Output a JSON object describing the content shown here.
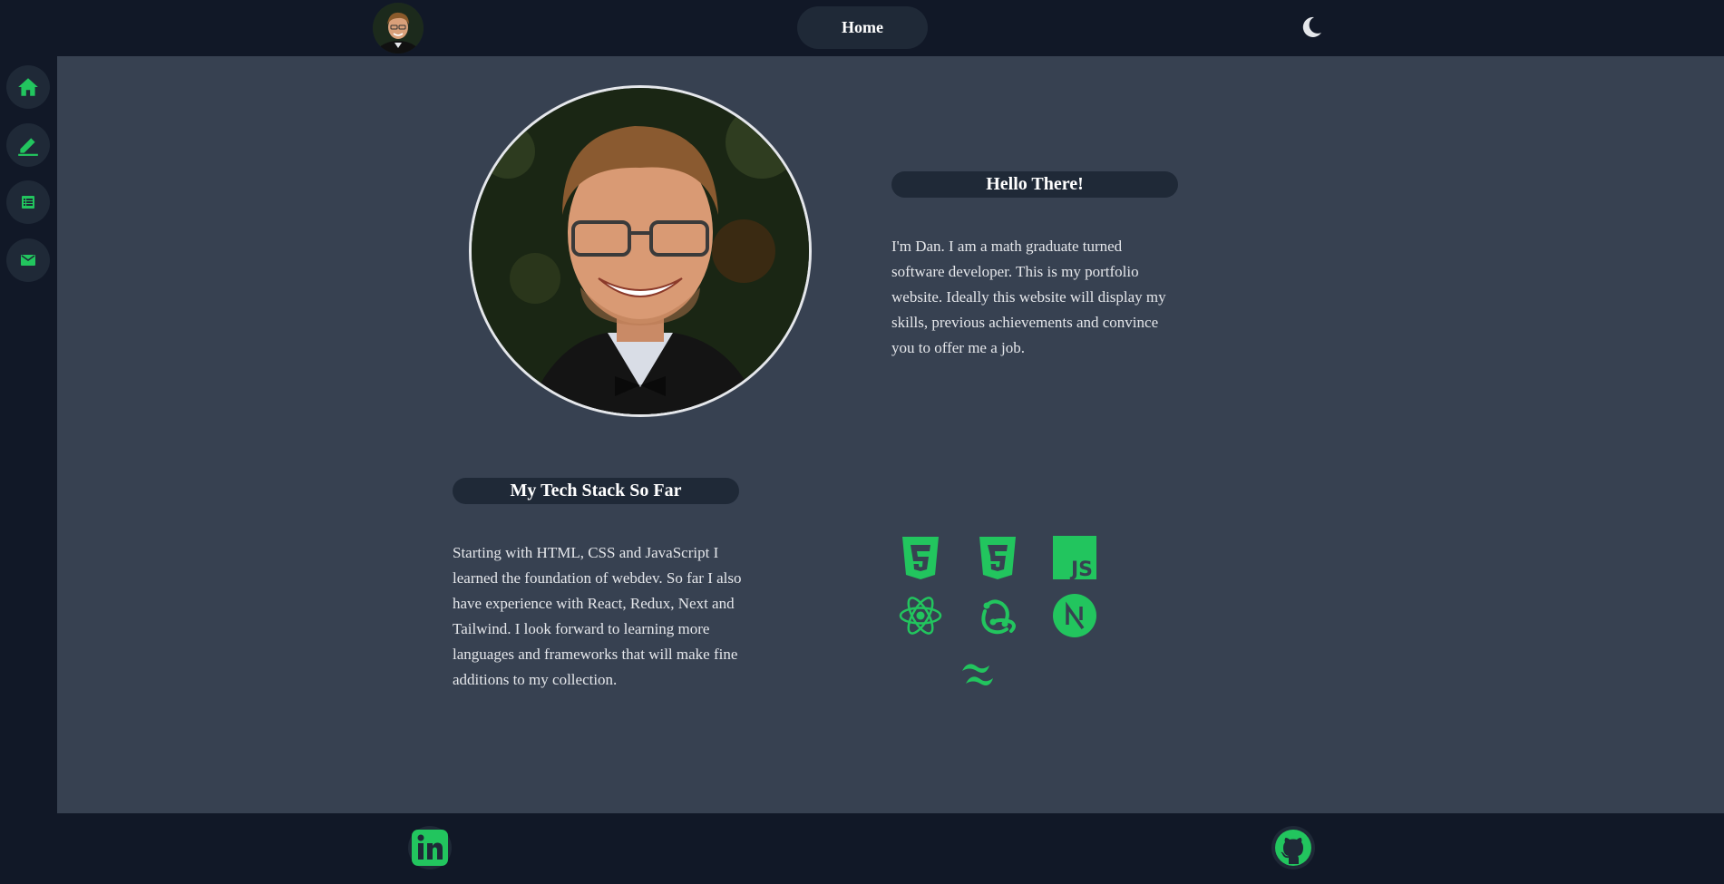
{
  "nav": {
    "home_label": "Home",
    "avatar_icon": "profile-avatar",
    "theme_icon": "moon-icon"
  },
  "sidebar": {
    "items": [
      {
        "icon": "home-icon"
      },
      {
        "icon": "pencil-icon"
      },
      {
        "icon": "list-icon"
      },
      {
        "icon": "mail-icon"
      }
    ]
  },
  "hero": {
    "title": "Hello There!",
    "text": "I'm Dan. I am a math graduate turned software developer. This is my portfolio website. Ideally this website will display my skills, previous achievements and convince you to offer me a job."
  },
  "tech": {
    "title": "My Tech Stack So Far",
    "text": "Starting with HTML, CSS and JavaScript I learned the foundation of webdev. So far I also have experience with React, Redux, Next and Tailwind. I look forward to learning more languages and frameworks that will make fine additions to my collection.",
    "icons": [
      "html5-icon",
      "css3-icon",
      "javascript-icon",
      "react-icon",
      "redux-icon",
      "nextjs-icon",
      "tailwind-icon"
    ]
  },
  "footer": {
    "icons": [
      "linkedin-icon",
      "github-icon"
    ]
  },
  "colors": {
    "accent": "#22c55e",
    "background": "#111827",
    "main": "#374151",
    "pill": "#1f2937",
    "text": "#e5e7eb"
  }
}
